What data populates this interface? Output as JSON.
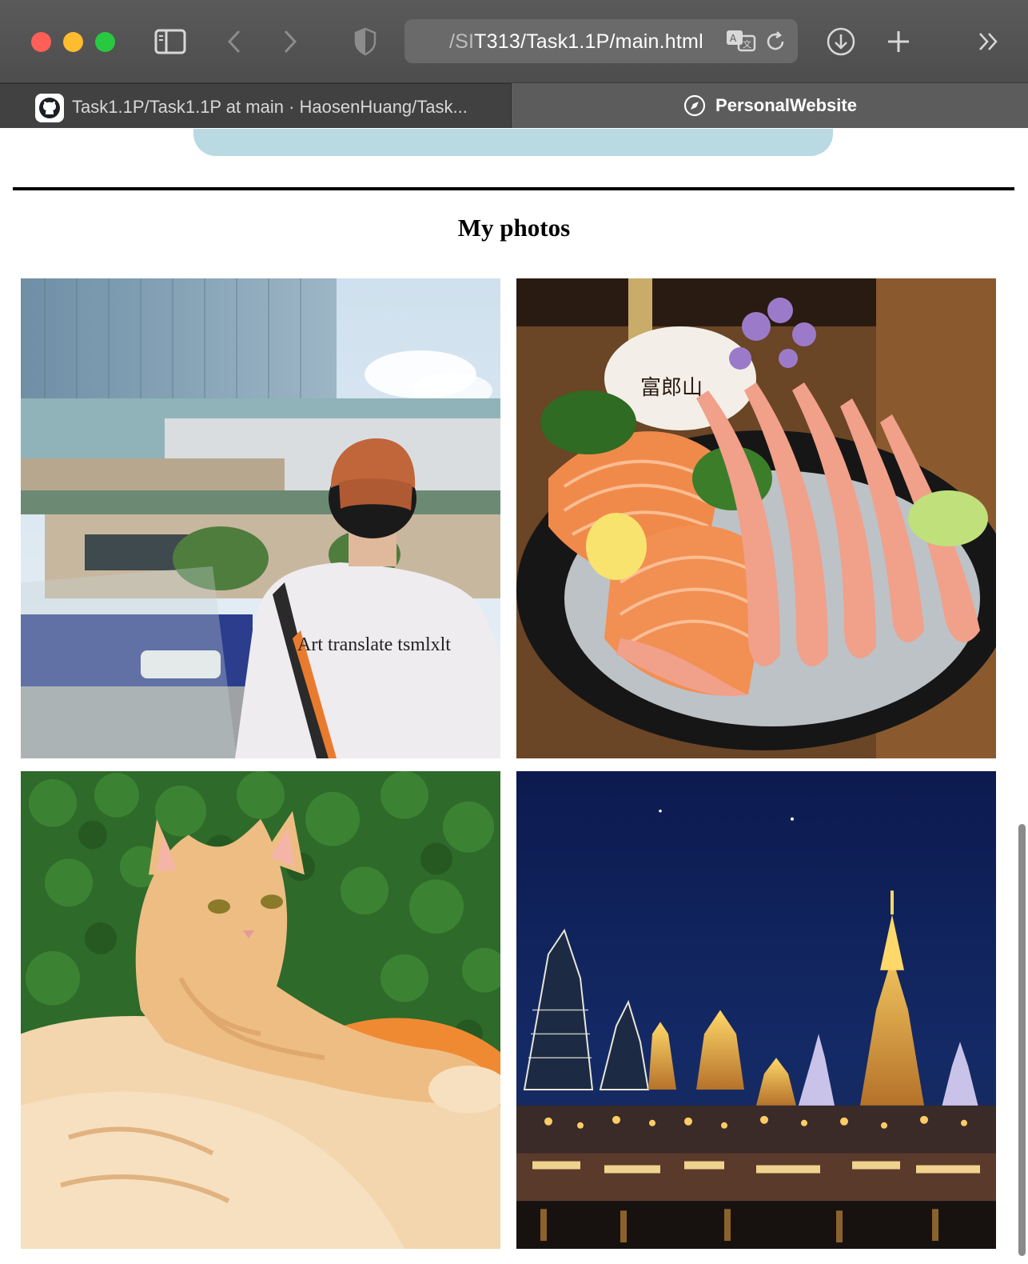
{
  "browser": {
    "url_prefix": "/SI",
    "url_main": "T313/Task1.1P/main.html",
    "tabs": [
      {
        "label": "Task1.1P/Task1.1P at main · HaosenHuang/Task...",
        "icon": "github-icon",
        "active": false
      },
      {
        "label": "PersonalWebsite",
        "icon": "compass-icon",
        "active": true
      }
    ],
    "buttons": {
      "sidebar": "sidebar-icon",
      "back": "chevron-left-icon",
      "forward": "chevron-right-icon",
      "privacy": "shield-icon",
      "translate": "translate-icon",
      "reload": "reload-icon",
      "download": "download-icon",
      "new_tab": "plus-icon",
      "more": "double-chevron-icon"
    }
  },
  "page": {
    "section_title": "My photos",
    "photos": [
      {
        "subject": "person-in-cap-at-plaza",
        "shirt_text": "Art translate tsmlxlt"
      },
      {
        "subject": "sashimi-platter",
        "sign_text": "富郎山"
      },
      {
        "subject": "orange-tabby-cat"
      },
      {
        "subject": "night-temple-skyline"
      }
    ]
  },
  "colors": {
    "toolbar": "#555555",
    "card_blue": "#b9d9e3",
    "rule": "#000000"
  }
}
